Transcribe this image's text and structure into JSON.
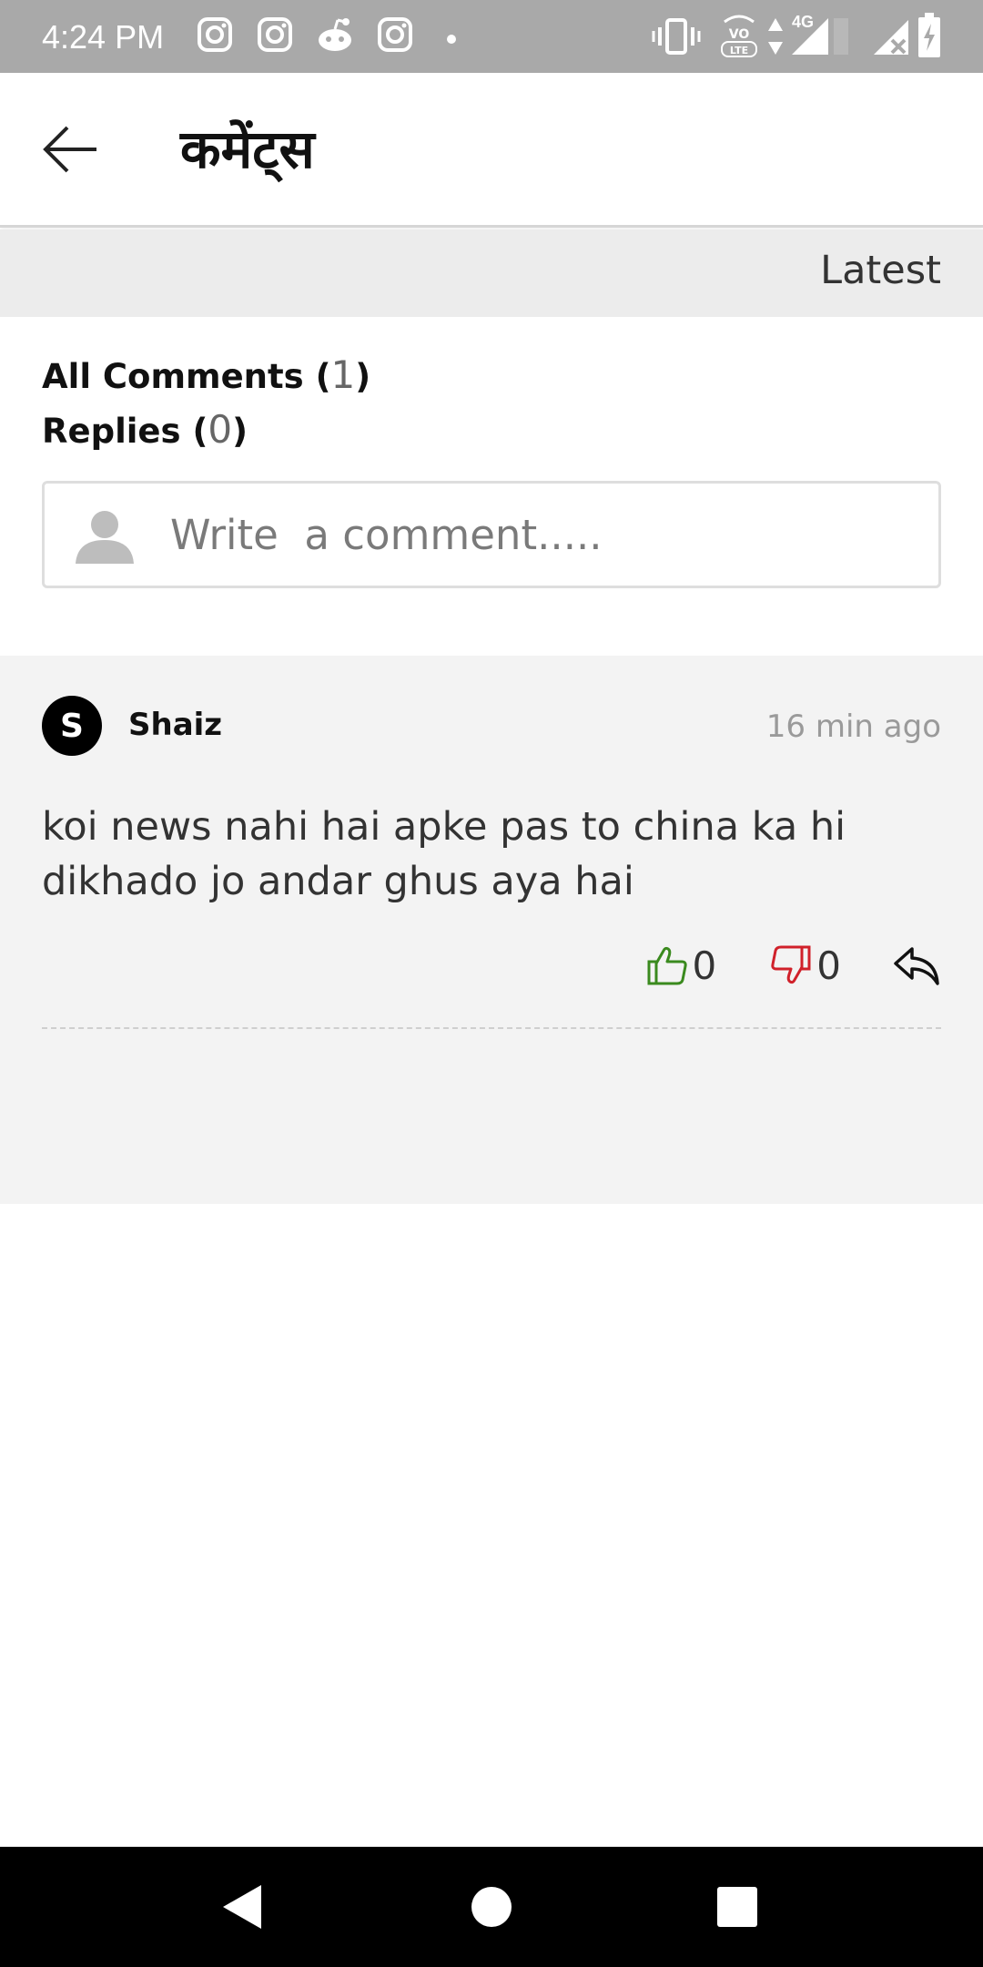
{
  "status_bar": {
    "time": "4:24 PM",
    "left_icons": [
      "instagram-icon",
      "instagram-icon",
      "reddit-icon",
      "instagram-icon",
      "dot-icon"
    ],
    "right_icons": [
      "vibrate-icon",
      "volte-icon",
      "data-arrows-icon",
      "signal-4g-icon",
      "signal-no-sim-icon",
      "battery-charging-icon"
    ],
    "network_label": "4G",
    "volte_label": "VO LTE"
  },
  "app_bar": {
    "back_icon": "arrow-left-icon",
    "title": "कमेंट्स"
  },
  "sort": {
    "label": "Latest"
  },
  "counts": {
    "all_label": "All Comments",
    "all_count": "1",
    "replies_label": "Replies",
    "replies_count": "0"
  },
  "comment_input": {
    "avatar_icon": "user-silhouette-icon",
    "placeholder": "Write  a comment....."
  },
  "comments": [
    {
      "avatar_letter": "S",
      "author": "Shaiz",
      "time": "16 min ago",
      "text": "koi news nahi hai apke pas to china ka hi dikhado jo andar ghus aya hai",
      "likes": "0",
      "dislikes": "0",
      "like_icon": "thumbs-up-icon",
      "dislike_icon": "thumbs-down-icon",
      "reply_icon": "reply-icon"
    }
  ],
  "colors": {
    "status_bar_bg": "#a9a9a9",
    "sort_strip_bg": "#ececec",
    "comments_bg": "#f3f3f3",
    "like_green": "#3a8a1e",
    "dislike_red": "#d0202a",
    "nav_bar_bg": "#000000"
  },
  "nav_bar": {
    "icons": [
      "nav-back-icon",
      "nav-home-icon",
      "nav-recents-icon"
    ]
  }
}
